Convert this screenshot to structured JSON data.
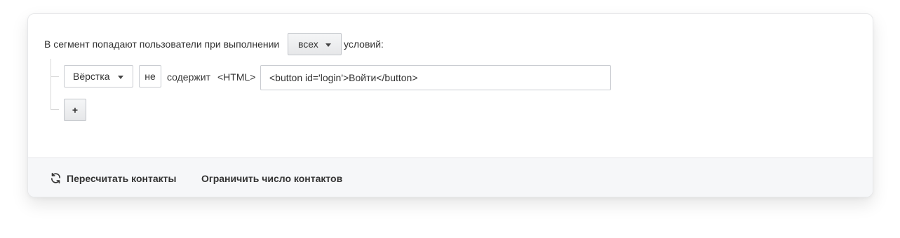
{
  "segment": {
    "intro_text": "В сегмент попадают пользователи при выполнении",
    "match_mode_value": "всех",
    "conditions_suffix": "условий:"
  },
  "condition": {
    "field_value": "Вёрстка",
    "negation_label": "не",
    "operator_text": "содержит",
    "type_tag": "<HTML>",
    "input_value": "<button id='login'>Войти</button>"
  },
  "add_condition_label": "+",
  "footer": {
    "recalculate_label": "Пересчитать контакты",
    "limit_label": "Ограничить число контактов"
  },
  "icons": {
    "recalculate": "refresh-icon",
    "dropdown": "caret-down-icon"
  },
  "colors": {
    "text": "#333333",
    "border": "#c9ccd1",
    "footer_bg": "#f6f7f9"
  }
}
